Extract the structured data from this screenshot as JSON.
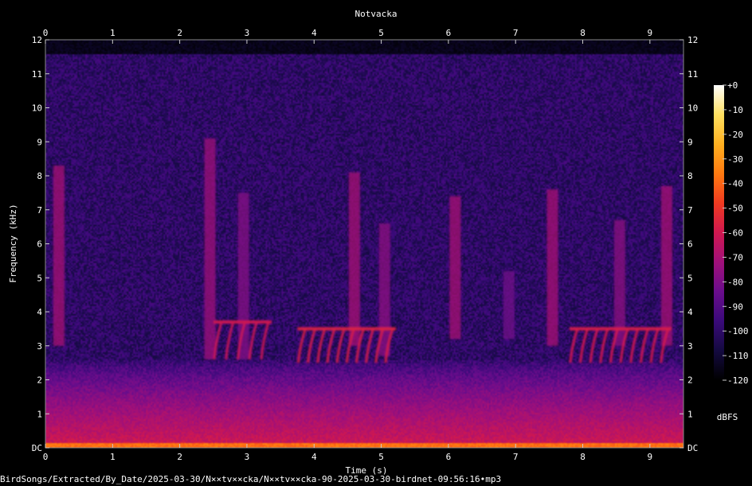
{
  "file_path": "BirdSongs/Extracted/By_Date/2025-03-30/N××tv××cka/N××tv××cka-90-2025-03-30-birdnet-09:56:16•mp3",
  "chart_data": {
    "type": "heatmap",
    "title": "Notvacka",
    "xlabel": "Time (s)",
    "ylabel": "Frequency (kHz)",
    "xlim": [
      0,
      9.5
    ],
    "ylim": [
      0,
      12
    ],
    "x_ticks": [
      "0",
      "1",
      "2",
      "3",
      "4",
      "5",
      "6",
      "7",
      "8",
      "9"
    ],
    "y_ticks": [
      "DC",
      "1",
      "2",
      "3",
      "4",
      "5",
      "6",
      "7",
      "8",
      "9",
      "10",
      "11",
      "12"
    ],
    "colorbar": {
      "unit": "dBFS",
      "range": [
        -120,
        0
      ],
      "ticks": [
        "+0",
        "-10",
        "-20",
        "-30",
        "-40",
        "-50",
        "-60",
        "-70",
        "-80",
        "-90",
        "-100",
        "-110",
        "-120"
      ],
      "colors": [
        "#000000",
        "#140a40",
        "#3a0a7a",
        "#6a0d8c",
        "#a0107a",
        "#d01850",
        "#f03a20",
        "#ff7a10",
        "#ffb020",
        "#ffe060",
        "#ffffff"
      ]
    },
    "background_level_db": -100,
    "low_band_level_db": -60,
    "bird_calls": [
      {
        "t": 0.2,
        "f_low": 3.0,
        "f_high": 8.3,
        "level_db": -70
      },
      {
        "t": 2.45,
        "f_low": 2.6,
        "f_high": 9.1,
        "level_db": -72
      },
      {
        "t": 2.95,
        "f_low": 2.6,
        "f_high": 7.5,
        "level_db": -78
      },
      {
        "t": 4.6,
        "f_low": 3.0,
        "f_high": 8.1,
        "level_db": -70
      },
      {
        "t": 5.05,
        "f_low": 2.7,
        "f_high": 6.6,
        "level_db": -76
      },
      {
        "t": 6.1,
        "f_low": 3.2,
        "f_high": 7.4,
        "level_db": -70
      },
      {
        "t": 6.9,
        "f_low": 3.2,
        "f_high": 5.2,
        "level_db": -82
      },
      {
        "t": 7.55,
        "f_low": 3.0,
        "f_high": 7.6,
        "level_db": -70
      },
      {
        "t": 8.55,
        "f_low": 3.0,
        "f_high": 6.7,
        "level_db": -76
      },
      {
        "t": 9.25,
        "f_low": 3.0,
        "f_high": 7.7,
        "level_db": -70
      }
    ],
    "trills": [
      {
        "t_start": 2.55,
        "t_end": 3.25,
        "f_low": 2.6,
        "f_high": 3.7,
        "strokes": 5,
        "level_db": -68
      },
      {
        "t_start": 3.8,
        "t_end": 5.1,
        "f_low": 2.5,
        "f_high": 3.5,
        "strokes": 10,
        "level_db": -65
      },
      {
        "t_start": 7.85,
        "t_end": 9.2,
        "f_low": 2.5,
        "f_high": 3.5,
        "strokes": 10,
        "level_db": -66
      }
    ]
  }
}
